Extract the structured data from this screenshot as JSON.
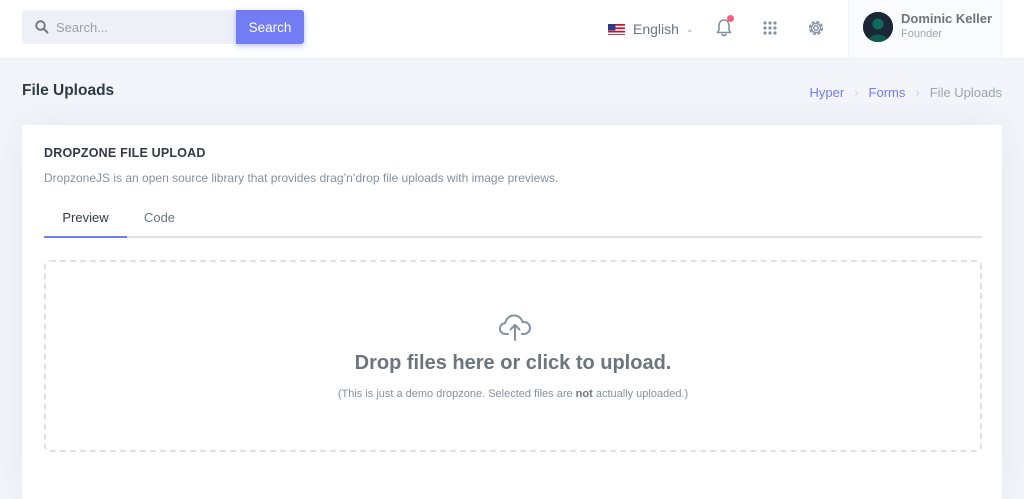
{
  "topbar": {
    "search_placeholder": "Search...",
    "search_button": "Search",
    "language": "English",
    "user_name": "Dominic Keller",
    "user_role": "Founder"
  },
  "page": {
    "title": "File Uploads",
    "breadcrumb": [
      "Hyper",
      "Forms",
      "File Uploads"
    ]
  },
  "card": {
    "title": "DROPZONE FILE UPLOAD",
    "description": "DropzoneJS is an open source library that provides drag’n’drop file uploads with image previews.",
    "tabs": [
      "Preview",
      "Code"
    ],
    "active_tab": "Preview"
  },
  "dropzone": {
    "title": "Drop files here or click to upload.",
    "note_prefix": "(This is just a demo dropzone. Selected files are ",
    "note_bold": "not",
    "note_suffix": " actually uploaded.)"
  },
  "icons": {
    "search": "search-icon",
    "flag": "us-flag-icon",
    "notifications": "bell-icon",
    "apps": "grid-icon",
    "settings": "gear-icon",
    "upload": "cloud-upload-icon"
  },
  "colors": {
    "primary": "#727cf5",
    "notification_dot": "#fa5c7c",
    "heading": "#313a46",
    "background": "#f4f5fb"
  }
}
